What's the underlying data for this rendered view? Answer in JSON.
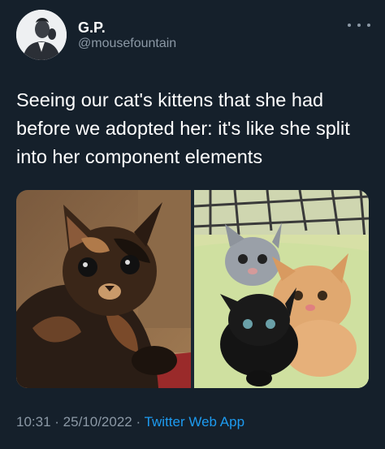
{
  "author": {
    "display_name": "G.P.",
    "handle": "@mousefountain",
    "avatar_icon": "profile-photo"
  },
  "more_icon": "more-dots-icon",
  "tweet": {
    "text": "Seeing our cat's kittens that she had before we adopted her: it's like she split into her component elements"
  },
  "media": [
    {
      "label": "tortoiseshell-cat-photo"
    },
    {
      "label": "three-kittens-photo"
    }
  ],
  "meta": {
    "time": "10:31",
    "separator_1": " · ",
    "date": "25/10/2022",
    "separator_2": " · ",
    "source": "Twitter Web App"
  },
  "colors": {
    "background": "#15202b",
    "text": "#ffffff",
    "secondary_text": "#8b98a5",
    "link": "#1d9bf0"
  }
}
